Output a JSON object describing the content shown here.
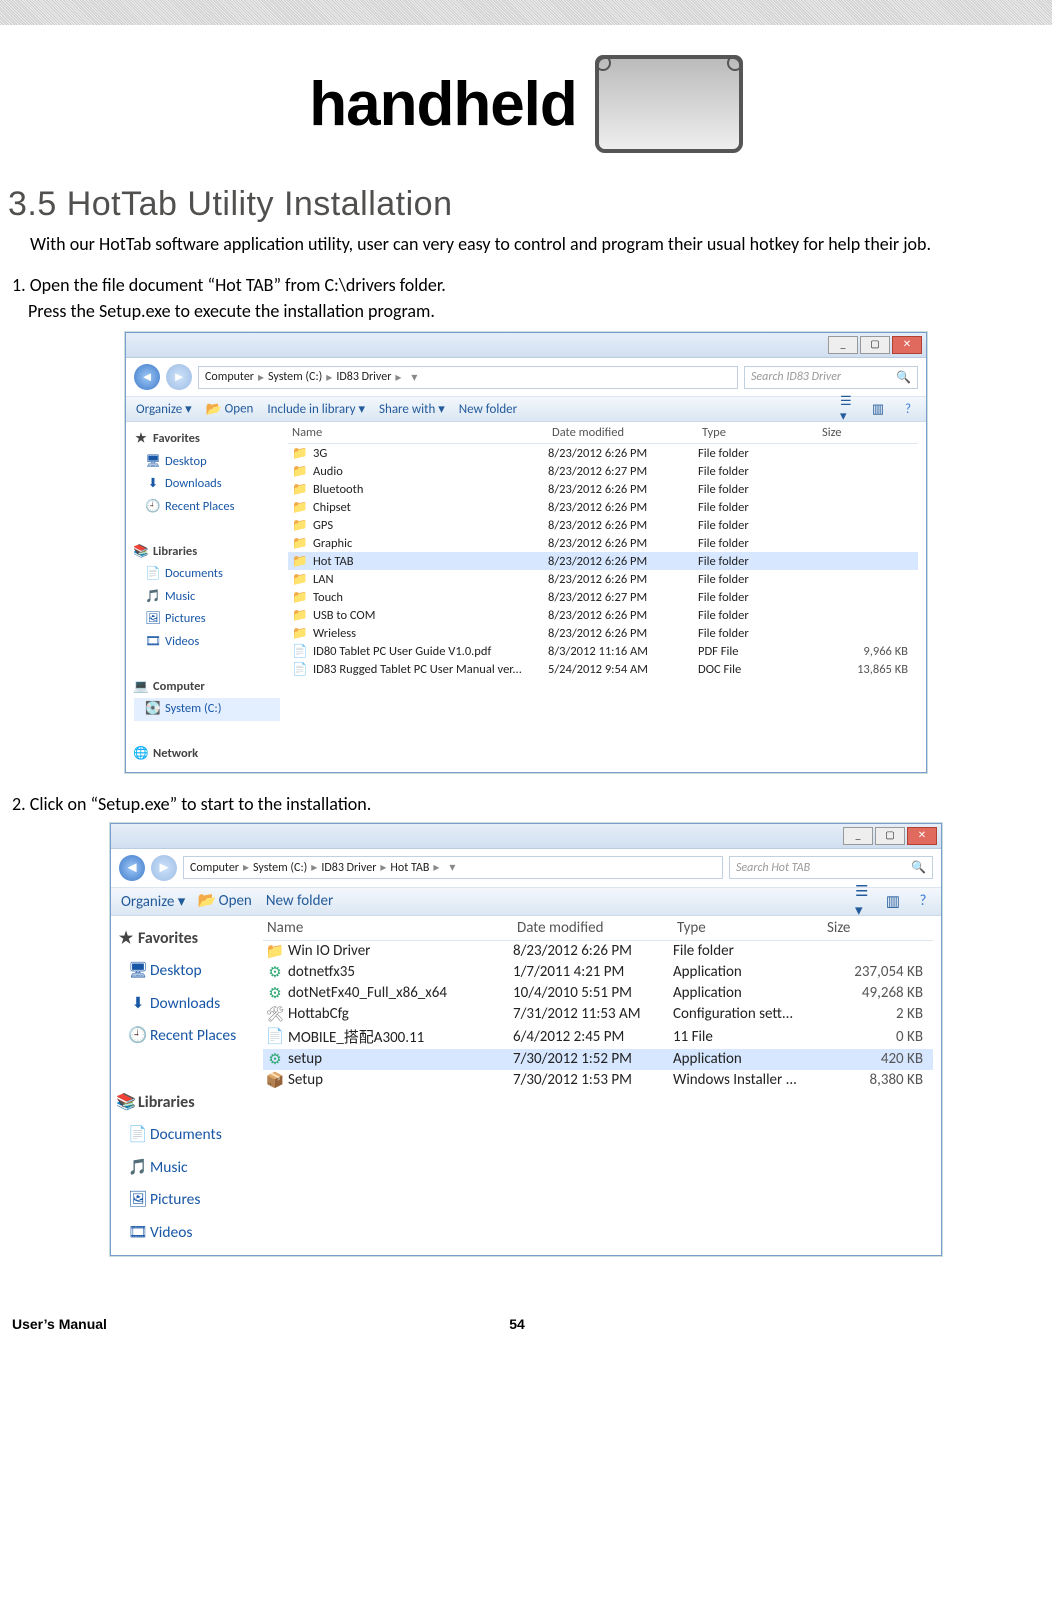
{
  "logo_text": "handheld",
  "section_title": "3.5  HotTab Utility Installation",
  "intro_text": "With our HotTab software application utility, user can very easy to control and program their usual hotkey for help their job.",
  "step1_text": "1.    Open the file document “Hot TAB” from C:\\drivers folder.",
  "step1_sub": "Press the Setup.exe to execute the installation program.",
  "step2_text": "2.    Click on “Setup.exe” to start to the installation.",
  "footer_left": "User’s Manual",
  "footer_page": "54",
  "win1": {
    "breadcrumb": [
      "Computer",
      "System (C:)",
      "ID83 Driver"
    ],
    "search_placeholder": "Search ID83 Driver",
    "toolbar": {
      "organize": "Organize",
      "open": "Open",
      "include": "Include in library",
      "share": "Share with",
      "newfolder": "New folder"
    },
    "nav": {
      "favorites": "Favorites",
      "fav_items": [
        "Desktop",
        "Downloads",
        "Recent Places"
      ],
      "libraries": "Libraries",
      "lib_items": [
        "Documents",
        "Music",
        "Pictures",
        "Videos"
      ],
      "computer": "Computer",
      "comp_items": [
        "System (C:)"
      ],
      "network": "Network"
    },
    "cols": {
      "name": "Name",
      "date": "Date modified",
      "type": "Type",
      "size": "Size"
    },
    "rows": [
      {
        "icon": "folder",
        "name": "3G",
        "date": "8/23/2012 6:26 PM",
        "type": "File folder",
        "size": ""
      },
      {
        "icon": "folder",
        "name": "Audio",
        "date": "8/23/2012 6:27 PM",
        "type": "File folder",
        "size": ""
      },
      {
        "icon": "folder",
        "name": "Bluetooth",
        "date": "8/23/2012 6:26 PM",
        "type": "File folder",
        "size": ""
      },
      {
        "icon": "folder",
        "name": "Chipset",
        "date": "8/23/2012 6:26 PM",
        "type": "File folder",
        "size": ""
      },
      {
        "icon": "folder",
        "name": "GPS",
        "date": "8/23/2012 6:26 PM",
        "type": "File folder",
        "size": ""
      },
      {
        "icon": "folder",
        "name": "Graphic",
        "date": "8/23/2012 6:26 PM",
        "type": "File folder",
        "size": ""
      },
      {
        "icon": "folder",
        "name": "Hot TAB",
        "date": "8/23/2012 6:26 PM",
        "type": "File folder",
        "size": "",
        "sel": true
      },
      {
        "icon": "folder",
        "name": "LAN",
        "date": "8/23/2012 6:26 PM",
        "type": "File folder",
        "size": ""
      },
      {
        "icon": "folder",
        "name": "Touch",
        "date": "8/23/2012 6:27 PM",
        "type": "File folder",
        "size": ""
      },
      {
        "icon": "folder",
        "name": "USB to COM",
        "date": "8/23/2012 6:26 PM",
        "type": "File folder",
        "size": ""
      },
      {
        "icon": "folder",
        "name": "Wrieless",
        "date": "8/23/2012 6:26 PM",
        "type": "File folder",
        "size": ""
      },
      {
        "icon": "pdf",
        "name": "ID80 Tablet PC User Guide V1.0.pdf",
        "date": "8/3/2012 11:16 AM",
        "type": "PDF File",
        "size": "9,966 KB"
      },
      {
        "icon": "doc",
        "name": "ID83 Rugged Tablet PC  User Manual ver...",
        "date": "5/24/2012 9:54 AM",
        "type": "DOC File",
        "size": "13,865 KB"
      }
    ]
  },
  "win2": {
    "breadcrumb": [
      "Computer",
      "System (C:)",
      "ID83 Driver",
      "Hot TAB"
    ],
    "search_placeholder": "Search Hot TAB",
    "toolbar": {
      "organize": "Organize",
      "open": "Open",
      "newfolder": "New folder"
    },
    "nav": {
      "favorites": "Favorites",
      "fav_items": [
        "Desktop",
        "Downloads",
        "Recent Places"
      ],
      "libraries": "Libraries",
      "lib_items": [
        "Documents",
        "Music",
        "Pictures",
        "Videos"
      ]
    },
    "cols": {
      "name": "Name",
      "date": "Date modified",
      "type": "Type",
      "size": "Size"
    },
    "rows": [
      {
        "icon": "folder",
        "name": "Win IO Driver",
        "date": "8/23/2012 6:26 PM",
        "type": "File folder",
        "size": ""
      },
      {
        "icon": "app",
        "name": "dotnetfx35",
        "date": "1/7/2011 4:21 PM",
        "type": "Application",
        "size": "237,054 KB"
      },
      {
        "icon": "app",
        "name": "dotNetFx40_Full_x86_x64",
        "date": "10/4/2010 5:51 PM",
        "type": "Application",
        "size": "49,268 KB"
      },
      {
        "icon": "cfg",
        "name": "HottabCfg",
        "date": "7/31/2012 11:53 AM",
        "type": "Configuration sett...",
        "size": "2 KB"
      },
      {
        "icon": "doc",
        "name": "MOBILE_搭配A300.11",
        "date": "6/4/2012 2:45 PM",
        "type": "11 File",
        "size": "0 KB"
      },
      {
        "icon": "app",
        "name": "setup",
        "date": "7/30/2012 1:52 PM",
        "type": "Application",
        "size": "420 KB",
        "sel": true
      },
      {
        "icon": "msi",
        "name": "Setup",
        "date": "7/30/2012 1:53 PM",
        "type": "Windows Installer ...",
        "size": "8,380 KB"
      }
    ]
  }
}
